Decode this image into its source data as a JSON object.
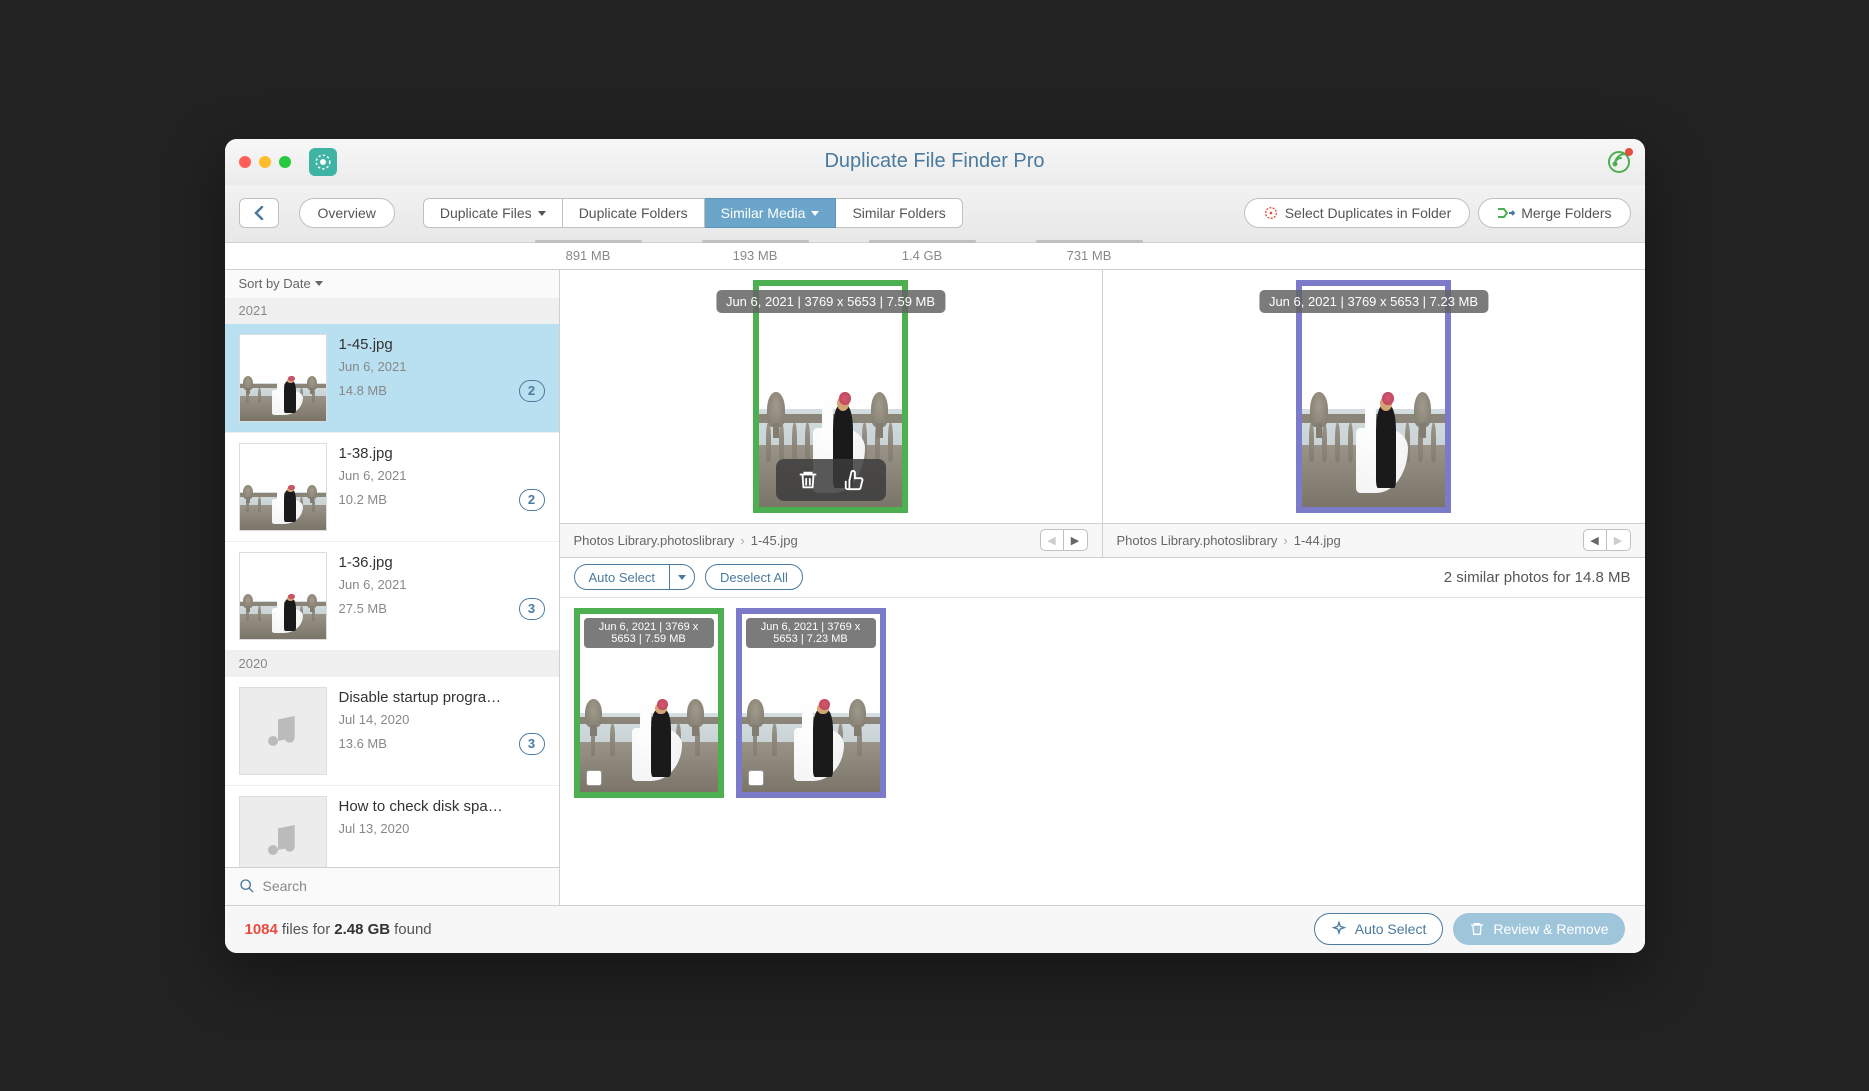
{
  "app": {
    "title": "Duplicate File Finder Pro"
  },
  "toolbar": {
    "overview": "Overview",
    "tabs": [
      {
        "label": "Duplicate Files",
        "size": "891 MB",
        "dropdown": true
      },
      {
        "label": "Duplicate Folders",
        "size": "193 MB"
      },
      {
        "label": "Similar Media",
        "size": "1.4 GB",
        "dropdown": true,
        "active": true
      },
      {
        "label": "Similar Folders",
        "size": "731 MB"
      }
    ],
    "select_in_folder": "Select Duplicates in Folder",
    "merge_folders": "Merge Folders"
  },
  "sidebar": {
    "sort_label": "Sort by Date",
    "search_placeholder": "Search",
    "sections": [
      {
        "year": "2021",
        "items": [
          {
            "name": "1-45.jpg",
            "date": "Jun 6, 2021",
            "size": "14.8 MB",
            "count": "2",
            "selected": true,
            "kind": "photo"
          },
          {
            "name": "1-38.jpg",
            "date": "Jun 6, 2021",
            "size": "10.2 MB",
            "count": "2",
            "kind": "photo"
          },
          {
            "name": "1-36.jpg",
            "date": "Jun 6, 2021",
            "size": "27.5 MB",
            "count": "3",
            "kind": "photo"
          }
        ]
      },
      {
        "year": "2020",
        "items": [
          {
            "name": "Disable startup progra…",
            "date": "Jul 14, 2020",
            "size": "13.6 MB",
            "count": "3",
            "kind": "audio"
          },
          {
            "name": "How to check disk spa…",
            "date": "Jul 13, 2020",
            "size": "",
            "count": "",
            "kind": "audio"
          }
        ]
      }
    ]
  },
  "preview": {
    "left": {
      "meta": "Jun 6, 2021 | 3769 x 5653 | 7.59 MB",
      "path_library": "Photos Library.photoslibrary",
      "path_file": "1-45.jpg",
      "color": "green"
    },
    "right": {
      "meta": "Jun 6, 2021 | 3769 x 5653 | 7.23 MB",
      "path_library": "Photos Library.photoslibrary",
      "path_file": "1-44.jpg",
      "color": "purple"
    }
  },
  "controls": {
    "auto_select": "Auto Select",
    "deselect_all": "Deselect All",
    "summary": "2 similar photos for 14.8 MB"
  },
  "strip": [
    {
      "meta": "Jun 6, 2021 | 3769 x 5653 | 7.59 MB",
      "color": "green"
    },
    {
      "meta": "Jun 6, 2021 | 3769 x 5653 | 7.23 MB",
      "color": "purple"
    }
  ],
  "footer": {
    "count": "1084",
    "mid": "files for",
    "size": "2.48 GB",
    "suffix": "found",
    "auto_select": "Auto Select",
    "review_remove": "Review & Remove"
  }
}
